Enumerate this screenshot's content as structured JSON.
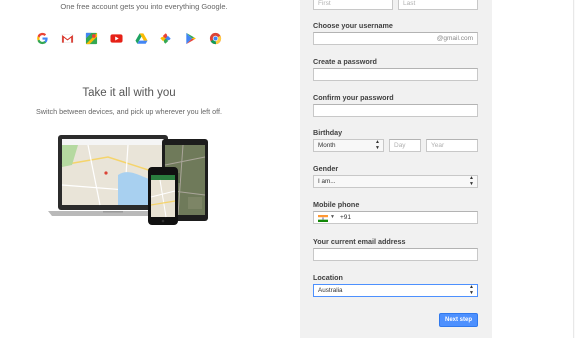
{
  "promo": {
    "tagline": "One free account gets you into everything Google.",
    "app_icons": [
      "google-icon",
      "gmail-icon",
      "maps-icon",
      "youtube-icon",
      "drive-icon",
      "photos-icon",
      "play-icon",
      "chrome-icon"
    ],
    "title": "Take it all with you",
    "subtitle": "Switch between devices, and pick up wherever you left off."
  },
  "form": {
    "name": {
      "first_placeholder": "First",
      "last_placeholder": "Last"
    },
    "username": {
      "label": "Choose your username",
      "suffix": "@gmail.com"
    },
    "password": {
      "label": "Create a password"
    },
    "confirm": {
      "label": "Confirm your password"
    },
    "birthday": {
      "label": "Birthday",
      "month": "Month",
      "day_placeholder": "Day",
      "year_placeholder": "Year"
    },
    "gender": {
      "label": "Gender",
      "value": "I am..."
    },
    "mobile": {
      "label": "Mobile phone",
      "code": "+91",
      "flag": "india-flag-icon"
    },
    "email": {
      "label": "Your current email address"
    },
    "location": {
      "label": "Location",
      "value": "Australia"
    },
    "next_label": "Next step"
  },
  "colors": {
    "panel": "#f1f1f1",
    "button": "#4d90fe",
    "focus_border": "#4d90fe"
  }
}
